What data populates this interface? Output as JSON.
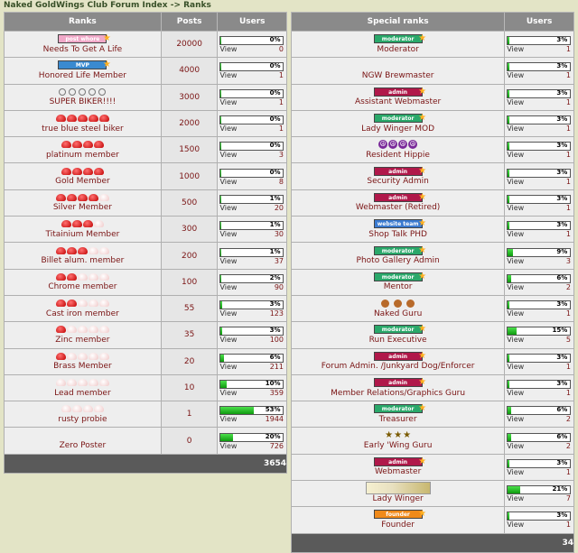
{
  "breadcrumb": {
    "text": "Naked GoldWings Club Forum Index -> Ranks"
  },
  "left": {
    "headers": {
      "ranks": "Ranks",
      "posts": "Posts",
      "users": "Users"
    },
    "rows": [
      {
        "name": "Needs To Get A Life",
        "posts": "20000",
        "pct": "0%",
        "fill": 0,
        "count": "0",
        "image": {
          "kind": "badge",
          "text": "post whore",
          "color": "#f0a8c8"
        }
      },
      {
        "name": "Honored Life Member",
        "posts": "4000",
        "pct": "0%",
        "fill": 0,
        "count": "1",
        "image": {
          "kind": "badge",
          "text": "MVP",
          "color": "#3a8ad0"
        }
      },
      {
        "name": "SUPER BIKER!!!!",
        "posts": "3000",
        "pct": "0%",
        "fill": 0,
        "count": "1",
        "image": {
          "kind": "circles",
          "n": 5
        }
      },
      {
        "name": "true blue steel biker",
        "posts": "2000",
        "pct": "0%",
        "fill": 0,
        "count": "1",
        "image": {
          "kind": "dots",
          "red": 5,
          "pale": 0
        }
      },
      {
        "name": "platinum member",
        "posts": "1500",
        "pct": "0%",
        "fill": 0,
        "count": "3",
        "image": {
          "kind": "dots",
          "red": 4,
          "pale": 0
        }
      },
      {
        "name": "Gold Member",
        "posts": "1000",
        "pct": "0%",
        "fill": 0,
        "count": "8",
        "image": {
          "kind": "dots",
          "red": 4,
          "pale": 0
        }
      },
      {
        "name": "Silver Member",
        "posts": "500",
        "pct": "1%",
        "fill": 1,
        "count": "20",
        "image": {
          "kind": "dots",
          "red": 4,
          "pale": 1
        }
      },
      {
        "name": "Titainium Member",
        "posts": "300",
        "pct": "1%",
        "fill": 1,
        "count": "30",
        "image": {
          "kind": "dots",
          "red": 3,
          "pale": 1
        }
      },
      {
        "name": "Billet alum. member",
        "posts": "200",
        "pct": "1%",
        "fill": 1,
        "count": "37",
        "image": {
          "kind": "dots",
          "red": 3,
          "pale": 2
        }
      },
      {
        "name": "Chrome member",
        "posts": "100",
        "pct": "2%",
        "fill": 2,
        "count": "90",
        "image": {
          "kind": "dots",
          "red": 2,
          "pale": 3
        }
      },
      {
        "name": "Cast iron member",
        "posts": "55",
        "pct": "3%",
        "fill": 3,
        "count": "123",
        "image": {
          "kind": "dots",
          "red": 2,
          "pale": 3
        }
      },
      {
        "name": "Zinc member",
        "posts": "35",
        "pct": "3%",
        "fill": 3,
        "count": "100",
        "image": {
          "kind": "dots",
          "red": 1,
          "pale": 4
        }
      },
      {
        "name": "Brass Member",
        "posts": "20",
        "pct": "6%",
        "fill": 6,
        "count": "211",
        "image": {
          "kind": "dots",
          "red": 1,
          "pale": 4
        }
      },
      {
        "name": "Lead member",
        "posts": "10",
        "pct": "10%",
        "fill": 10,
        "count": "359",
        "image": {
          "kind": "dots",
          "red": 0,
          "pale": 5
        }
      },
      {
        "name": "rusty probie",
        "posts": "1",
        "pct": "53%",
        "fill": 53,
        "count": "1944",
        "image": {
          "kind": "dots",
          "red": 0,
          "pale": 4
        }
      },
      {
        "name": "Zero Poster",
        "posts": "0",
        "pct": "20%",
        "fill": 20,
        "count": "726",
        "image": {
          "kind": "none"
        }
      }
    ],
    "total": "3654"
  },
  "right": {
    "headers": {
      "ranks": "Special ranks",
      "users": "Users"
    },
    "rows": [
      {
        "name": "Moderator",
        "pct": "3%",
        "fill": 3,
        "count": "1",
        "image": {
          "kind": "badge",
          "text": "moderator",
          "color": "#2aa86a"
        }
      },
      {
        "name": "NGW Brewmaster",
        "pct": "3%",
        "fill": 3,
        "count": "1",
        "image": {
          "kind": "none"
        }
      },
      {
        "name": "Assistant Webmaster",
        "pct": "3%",
        "fill": 3,
        "count": "1",
        "image": {
          "kind": "badge",
          "text": "admin",
          "color": "#b0184a"
        }
      },
      {
        "name": "Lady Winger MOD",
        "pct": "3%",
        "fill": 3,
        "count": "1",
        "image": {
          "kind": "badge",
          "text": "moderator",
          "color": "#2aa86a"
        }
      },
      {
        "name": "Resident Hippie",
        "pct": "3%",
        "fill": 3,
        "count": "1",
        "image": {
          "kind": "peace",
          "n": 4
        }
      },
      {
        "name": "Security Admin",
        "pct": "3%",
        "fill": 3,
        "count": "1",
        "image": {
          "kind": "badge",
          "text": "admin",
          "color": "#b0184a"
        }
      },
      {
        "name": "Webmaster (Retired)",
        "pct": "3%",
        "fill": 3,
        "count": "1",
        "image": {
          "kind": "badge",
          "text": "admin",
          "color": "#b0184a"
        }
      },
      {
        "name": "Shop Talk PHD",
        "pct": "3%",
        "fill": 3,
        "count": "1",
        "image": {
          "kind": "badge",
          "text": "website team",
          "color": "#3a7ad0"
        }
      },
      {
        "name": "Photo Gallery Admin",
        "pct": "9%",
        "fill": 9,
        "count": "3",
        "image": {
          "kind": "badge",
          "text": "moderator",
          "color": "#2aa86a"
        }
      },
      {
        "name": "Mentor",
        "pct": "6%",
        "fill": 6,
        "count": "2",
        "image": {
          "kind": "badge",
          "text": "moderator",
          "color": "#2aa86a"
        }
      },
      {
        "name": "Naked Guru",
        "pct": "3%",
        "fill": 3,
        "count": "1",
        "image": {
          "kind": "paws",
          "n": 3
        }
      },
      {
        "name": "Run Executive",
        "pct": "15%",
        "fill": 15,
        "count": "5",
        "image": {
          "kind": "badge",
          "text": "moderator",
          "color": "#2aa86a"
        }
      },
      {
        "name": "Forum Admin. /Junkyard Dog/Enforcer",
        "pct": "3%",
        "fill": 3,
        "count": "1",
        "image": {
          "kind": "badge",
          "text": "admin",
          "color": "#b0184a"
        }
      },
      {
        "name": "Member Relations/Graphics Guru",
        "pct": "3%",
        "fill": 3,
        "count": "1",
        "image": {
          "kind": "badge",
          "text": "admin",
          "color": "#b0184a"
        }
      },
      {
        "name": "Treasurer",
        "pct": "6%",
        "fill": 6,
        "count": "2",
        "image": {
          "kind": "badge",
          "text": "moderator",
          "color": "#2aa86a"
        }
      },
      {
        "name": "Early 'Wing Guru",
        "pct": "6%",
        "fill": 6,
        "count": "2",
        "image": {
          "kind": "stars",
          "n": 3
        }
      },
      {
        "name": "Webmaster",
        "pct": "3%",
        "fill": 3,
        "count": "1",
        "image": {
          "kind": "badge",
          "text": "admin",
          "color": "#b0184a"
        }
      },
      {
        "name": "Lady Winger",
        "pct": "21%",
        "fill": 21,
        "count": "7",
        "image": {
          "kind": "photo"
        }
      },
      {
        "name": "Founder",
        "pct": "3%",
        "fill": 3,
        "count": "1",
        "image": {
          "kind": "badge",
          "text": "founder",
          "color": "#f08a1a"
        }
      }
    ],
    "total": "34"
  },
  "view_label": "View"
}
